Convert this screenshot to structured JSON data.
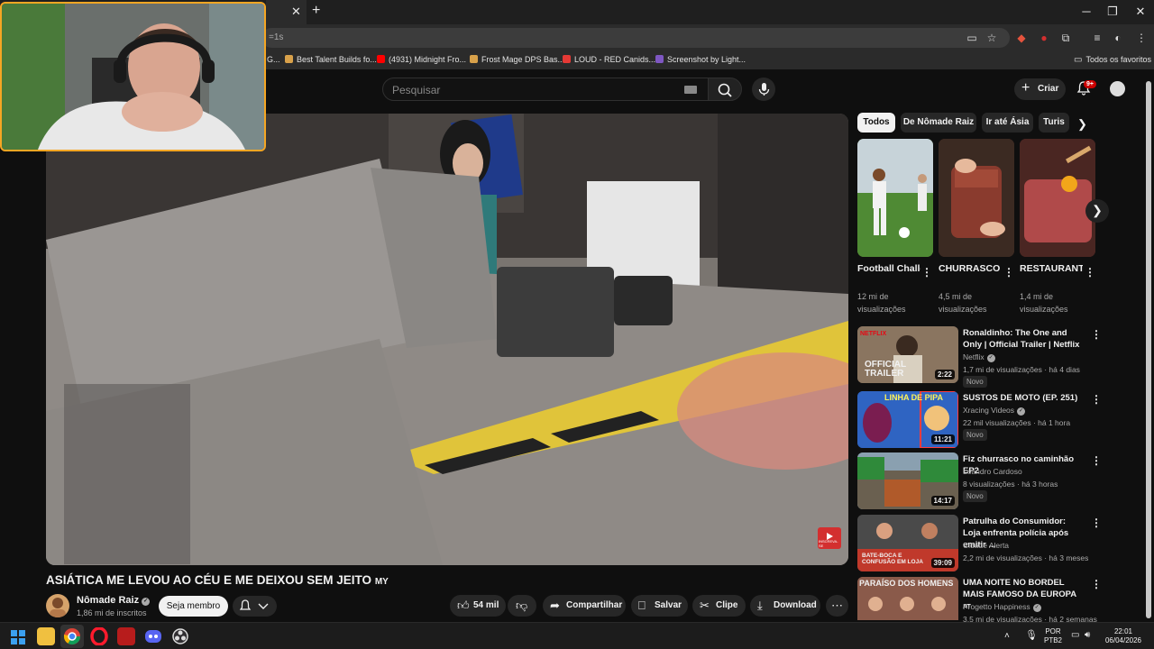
{
  "browser": {
    "url_fragment": "=1s",
    "bookmarks": [
      {
        "label": "G...",
        "color": "#888888"
      },
      {
        "label": "Best Talent Builds fo...",
        "color": "#d8a14a"
      },
      {
        "label": "(4931) Midnight Fro...",
        "color": "#ff0000"
      },
      {
        "label": "Frost Mage DPS Bas...",
        "color": "#d8a14a"
      },
      {
        "label": "LOUD - RED Canids...",
        "color": "#e53935"
      },
      {
        "label": "Screenshot by Light...",
        "color": "#7e57c2"
      }
    ],
    "all_bookmarks": "Todos os favoritos"
  },
  "header": {
    "search_placeholder": "Pesquisar",
    "create_label": "Criar",
    "notifications": "9+"
  },
  "video": {
    "title": "ASIÁTICA ME LEVOU AO CÉU E ME DEIXOU SEM JEITO",
    "title_suffix": "MY",
    "channel_name": "Nômade Raiz",
    "subscribers": "1,86 mi de inscritos",
    "join_label": "Seja membro",
    "likes": "54 mil",
    "share_label": "Compartilhar",
    "save_label": "Salvar",
    "clip_label": "Clipe",
    "download_label": "Download"
  },
  "chips": [
    "Todos",
    "De Nômade Raiz",
    "Ir até Ásia",
    "Turis"
  ],
  "shorts": [
    {
      "title": "Football Challenge ...",
      "views": "12 mi de visualizações"
    },
    {
      "title": "CHURRASCO AMERICAN...",
      "views": "4,5 mi de visualizações"
    },
    {
      "title": "RESTAURANTE de ...",
      "views": "1,4 mi de visualizações"
    }
  ],
  "recommendations": [
    {
      "title": "Ronaldinho: The One and Only | Official Trailer | Netflix",
      "channel": "Netflix",
      "meta": "1,7 mi de visualizações · há 4 dias",
      "badge": "Novo",
      "duration": "2:22",
      "thumb_text": "OFFICIAL TRAILER"
    },
    {
      "title": "SUSTOS DE MOTO (EP. 251)",
      "channel": "Xracing Videos",
      "meta": "22 mil visualizações · há 1 hora",
      "badge": "Novo",
      "duration": "11:21",
      "thumb_text": "LINHA DE PIPA"
    },
    {
      "title": "Fiz churrasco no caminhão EP2",
      "channel": "Leandro Cardoso",
      "meta": "8 visualizações · há 3 horas",
      "badge": "Novo",
      "duration": "14:17",
      "thumb_text": ""
    },
    {
      "title": "Patrulha do Consumidor: Loja enfrenta polícia após emitir ...",
      "channel": "Cidade Alerta",
      "meta": "2,2 mi de visualizações · há 3 meses",
      "badge": "",
      "duration": "39:09",
      "thumb_text": "BATE-BOCA E CONFUSÃO EM LOJA"
    },
    {
      "title": "UMA NOITE NO BORDEL MAIS FAMOSO DA EUROPA",
      "title_tag": "AT",
      "channel": "Progetto Happiness",
      "meta": "3,5 mi de visualizações · há 2 semanas",
      "badge": "",
      "duration": "",
      "thumb_text": "PARAÍSO DOS HOMENS"
    }
  ],
  "taskbar": {
    "language": "POR",
    "layout": "PTB2",
    "time": "22:01",
    "date": "06/04/2026"
  }
}
